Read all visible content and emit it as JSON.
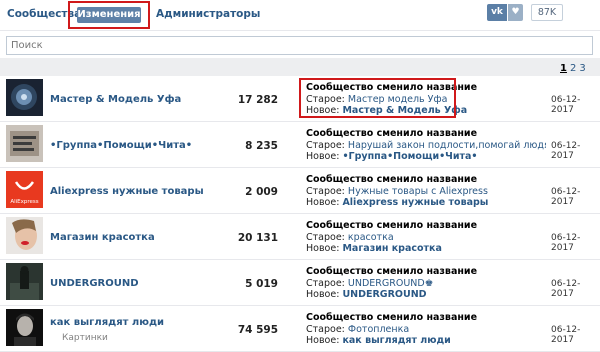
{
  "tabs": {
    "communities": "Сообщества",
    "changes": "Изменения",
    "admins": "Администраторы"
  },
  "share": {
    "vk": "vk",
    "count": "87K"
  },
  "search": {
    "placeholder": "Поиск"
  },
  "pager": {
    "current": "1",
    "pages": [
      "2",
      "3"
    ]
  },
  "labels": {
    "old": "Старое:",
    "new": "Новое:"
  },
  "rows": [
    {
      "name": "Мастер & Модель Уфа",
      "count": "17 282",
      "title": "Сообщество сменило название",
      "old": "Мастер модель Уфа",
      "new": "Мастер & Модель Уфа",
      "date": "06-12-2017"
    },
    {
      "name": "•Группа•Помощи•Чита•",
      "count": "8 235",
      "title": "Сообщество сменило название",
      "old": "Нарушай закон подлости,помогай людям.Чита",
      "new": "•Группа•Помощи•Чита•",
      "date": "06-12-2017"
    },
    {
      "name": "Aliexpress нужные товары",
      "count": "2 009",
      "title": "Сообщество сменило название",
      "old": "Нужные товары с Aliexpress",
      "new": "Aliexpress нужные товары",
      "date": "06-12-2017"
    },
    {
      "name": "Магазин красотка",
      "count": "20 131",
      "title": "Сообщество сменило название",
      "old": "красотка",
      "new": "Магазин красотка",
      "date": "06-12-2017"
    },
    {
      "name": "UNDERGROUND",
      "count": "5 019",
      "title": "Сообщество сменило название",
      "old": "UNDERGROUND♚",
      "new": "UNDERGROUND",
      "date": "06-12-2017"
    },
    {
      "name": "как выглядят люди",
      "sub": "Картинки",
      "count": "74 595",
      "title": "Сообщество сменило название",
      "old": "Фотопленка",
      "new": "как выглядят люди",
      "date": "06-12-2017"
    }
  ],
  "avatars": [
    {
      "name": "avatar-master-model-icon",
      "bg": "#1f2a3a"
    },
    {
      "name": "avatar-group-help-icon",
      "bg": "#b9b3ad"
    },
    {
      "name": "avatar-aliexpress-icon",
      "bg": "#e8351f",
      "text": "AliExpress"
    },
    {
      "name": "avatar-beauty-shop-icon",
      "bg": "#d8d4d0"
    },
    {
      "name": "avatar-underground-icon",
      "bg": "#2e3a34"
    },
    {
      "name": "avatar-how-people-look-icon",
      "bg": "#121212"
    }
  ]
}
